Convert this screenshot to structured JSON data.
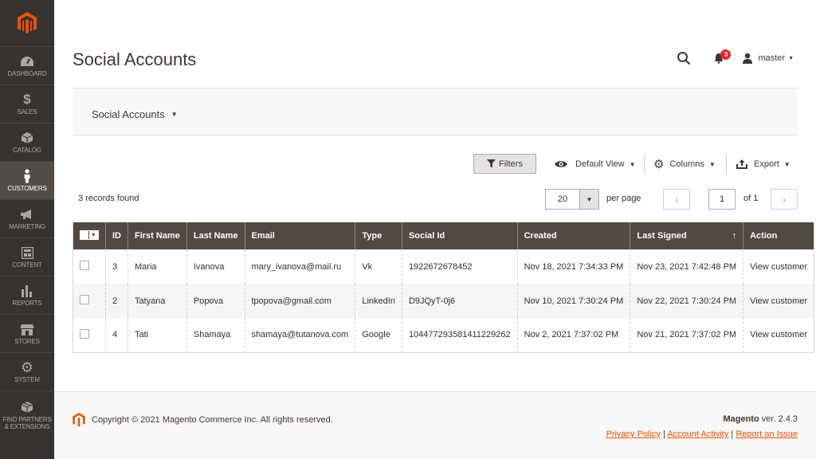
{
  "sidebar": {
    "items": [
      {
        "label": "DASHBOARD",
        "icon": "dashboard-icon"
      },
      {
        "label": "SALES",
        "icon": "dollar-icon"
      },
      {
        "label": "CATALOG",
        "icon": "cube-icon"
      },
      {
        "label": "CUSTOMERS",
        "icon": "person-icon"
      },
      {
        "label": "MARKETING",
        "icon": "megaphone-icon"
      },
      {
        "label": "CONTENT",
        "icon": "layout-icon"
      },
      {
        "label": "REPORTS",
        "icon": "bar-chart-icon"
      },
      {
        "label": "STORES",
        "icon": "store-icon"
      },
      {
        "label": "SYSTEM",
        "icon": "gear-icon"
      },
      {
        "label": "FIND PARTNERS & EXTENSIONS",
        "icon": "box-icon"
      }
    ]
  },
  "header": {
    "title": "Social Accounts",
    "notifications_count": "3",
    "user_name": "master"
  },
  "scope": {
    "label": "Social Accounts"
  },
  "toolbar": {
    "filters_label": "Filters",
    "view_label": "Default View",
    "columns_label": "Columns",
    "export_label": "Export"
  },
  "pager": {
    "records_found": "3 records found",
    "per_page_value": "20",
    "per_page_label": "per page",
    "current_page": "1",
    "of_pages": "of 1"
  },
  "grid": {
    "columns": [
      "ID",
      "First Name",
      "Last Name",
      "Email",
      "Type",
      "Social Id",
      "Created",
      "Last Signed",
      "Action"
    ],
    "sort_arrow": "↑",
    "rows": [
      {
        "id": "3",
        "first_name": "Maria",
        "last_name": "Ivanova",
        "email": "mary_ivanova@mail.ru",
        "type": "Vk",
        "social_id": "1922672678452",
        "created": "Nov 18, 2021 7:34:33 PM",
        "last_signed": "Nov 23, 2021 7:42:48 PM",
        "action": "View customer"
      },
      {
        "id": "2",
        "first_name": "Tatyana",
        "last_name": "Popova",
        "email": "tpopova@gmail.com",
        "type": "LinkedIn",
        "social_id": "D9JQyT-0j6",
        "created": "Nov 10, 2021 7:30:24 PM",
        "last_signed": "Nov 22, 2021 7:30:24 PM",
        "action": "View customer"
      },
      {
        "id": "4",
        "first_name": "Tati",
        "last_name": "Shamaya",
        "email": "shamaya@tutanova.com",
        "type": "Google",
        "social_id": "104477293581411229262",
        "created": "Nov 2, 2021 7:37:02 PM",
        "last_signed": "Nov 21, 2021 7:37:02 PM",
        "action": "View customer"
      }
    ]
  },
  "footer": {
    "copyright": "Copyright © 2021 Magento Commerce Inc. All rights reserved.",
    "brand": "Magento",
    "version": " ver. 2.4.3",
    "links": [
      "Privacy Policy",
      "Account Activity",
      "Report an Issue"
    ],
    "separator": "|"
  },
  "colors": {
    "brand_orange": "#eb5202",
    "sidebar_bg": "#373330",
    "table_header_bg": "#514943",
    "link_blue": "#007bdb",
    "badge_red": "#e22626"
  }
}
